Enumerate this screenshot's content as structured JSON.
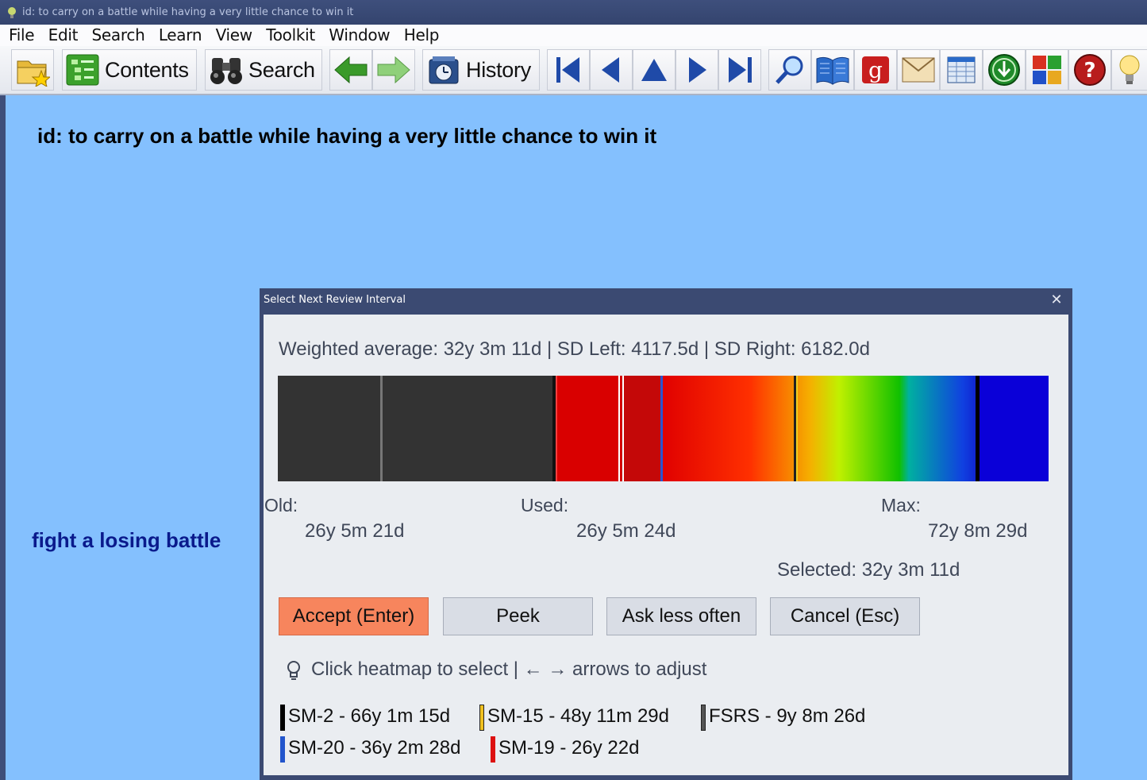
{
  "window": {
    "title": "id: to carry on a battle while having a very little chance to win it"
  },
  "menu": [
    "File",
    "Edit",
    "Search",
    "Learn",
    "View",
    "Toolkit",
    "Window",
    "Help"
  ],
  "toolbar": {
    "contents_label": "Contents",
    "search_label": "Search",
    "history_label": "History"
  },
  "content": {
    "question": "id: to carry on a battle while having a very little chance to win it",
    "answer": "fight a losing battle"
  },
  "dialog": {
    "title": "Select Next Review Interval",
    "close": "✕",
    "summary": "Weighted average: 32y 3m 11d | SD Left: 4117.5d | SD Right: 6182.0d",
    "old_label": "Old:",
    "old_value": "26y 5m 21d",
    "used_label": "Used:",
    "used_value": "26y 5m 24d",
    "max_label": "Max:",
    "max_value": "72y 8m 29d",
    "selected": "Selected: 32y 3m 11d",
    "buttons": {
      "accept": "Accept (Enter)",
      "peek": "Peek",
      "ask_less": "Ask less often",
      "cancel": "Cancel (Esc)"
    },
    "hint": "Click heatmap to select | ← → arrows to adjust",
    "legend": [
      {
        "label": "SM-2 - 66y 1m 15d",
        "color": "#000000"
      },
      {
        "label": "SM-15 - 48y 11m 29d",
        "color": "#f0c020"
      },
      {
        "label": "FSRS - 9y 8m 26d",
        "color": "#555555"
      },
      {
        "label": "SM-20 - 36y 2m 28d",
        "color": "#2255cc"
      },
      {
        "label": "SM-19 - 26y 22d",
        "color": "#dd1111"
      }
    ]
  },
  "colors": {
    "background": "#84c0fe",
    "accent_button": "#f7855d",
    "answer_text": "#0a1a8c"
  }
}
